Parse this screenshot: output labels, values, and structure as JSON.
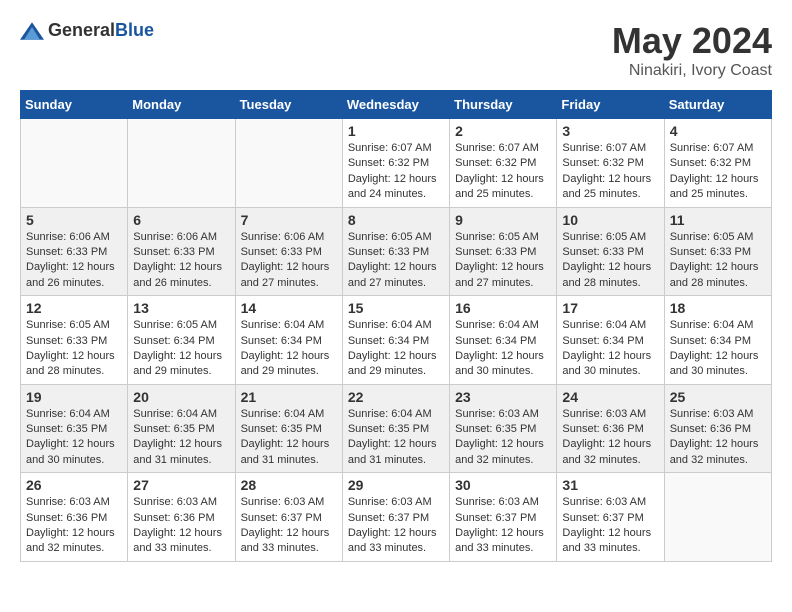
{
  "header": {
    "logo_general": "General",
    "logo_blue": "Blue",
    "month_year": "May 2024",
    "location": "Ninakiri, Ivory Coast"
  },
  "calendar": {
    "days_of_week": [
      "Sunday",
      "Monday",
      "Tuesday",
      "Wednesday",
      "Thursday",
      "Friday",
      "Saturday"
    ],
    "weeks": [
      {
        "shaded": false,
        "days": [
          {
            "number": "",
            "info": "",
            "empty": true
          },
          {
            "number": "",
            "info": "",
            "empty": true
          },
          {
            "number": "",
            "info": "",
            "empty": true
          },
          {
            "number": "1",
            "info": "Sunrise: 6:07 AM\nSunset: 6:32 PM\nDaylight: 12 hours\nand 24 minutes.",
            "empty": false
          },
          {
            "number": "2",
            "info": "Sunrise: 6:07 AM\nSunset: 6:32 PM\nDaylight: 12 hours\nand 25 minutes.",
            "empty": false
          },
          {
            "number": "3",
            "info": "Sunrise: 6:07 AM\nSunset: 6:32 PM\nDaylight: 12 hours\nand 25 minutes.",
            "empty": false
          },
          {
            "number": "4",
            "info": "Sunrise: 6:07 AM\nSunset: 6:32 PM\nDaylight: 12 hours\nand 25 minutes.",
            "empty": false
          }
        ]
      },
      {
        "shaded": true,
        "days": [
          {
            "number": "5",
            "info": "Sunrise: 6:06 AM\nSunset: 6:33 PM\nDaylight: 12 hours\nand 26 minutes.",
            "empty": false
          },
          {
            "number": "6",
            "info": "Sunrise: 6:06 AM\nSunset: 6:33 PM\nDaylight: 12 hours\nand 26 minutes.",
            "empty": false
          },
          {
            "number": "7",
            "info": "Sunrise: 6:06 AM\nSunset: 6:33 PM\nDaylight: 12 hours\nand 27 minutes.",
            "empty": false
          },
          {
            "number": "8",
            "info": "Sunrise: 6:05 AM\nSunset: 6:33 PM\nDaylight: 12 hours\nand 27 minutes.",
            "empty": false
          },
          {
            "number": "9",
            "info": "Sunrise: 6:05 AM\nSunset: 6:33 PM\nDaylight: 12 hours\nand 27 minutes.",
            "empty": false
          },
          {
            "number": "10",
            "info": "Sunrise: 6:05 AM\nSunset: 6:33 PM\nDaylight: 12 hours\nand 28 minutes.",
            "empty": false
          },
          {
            "number": "11",
            "info": "Sunrise: 6:05 AM\nSunset: 6:33 PM\nDaylight: 12 hours\nand 28 minutes.",
            "empty": false
          }
        ]
      },
      {
        "shaded": false,
        "days": [
          {
            "number": "12",
            "info": "Sunrise: 6:05 AM\nSunset: 6:33 PM\nDaylight: 12 hours\nand 28 minutes.",
            "empty": false
          },
          {
            "number": "13",
            "info": "Sunrise: 6:05 AM\nSunset: 6:34 PM\nDaylight: 12 hours\nand 29 minutes.",
            "empty": false
          },
          {
            "number": "14",
            "info": "Sunrise: 6:04 AM\nSunset: 6:34 PM\nDaylight: 12 hours\nand 29 minutes.",
            "empty": false
          },
          {
            "number": "15",
            "info": "Sunrise: 6:04 AM\nSunset: 6:34 PM\nDaylight: 12 hours\nand 29 minutes.",
            "empty": false
          },
          {
            "number": "16",
            "info": "Sunrise: 6:04 AM\nSunset: 6:34 PM\nDaylight: 12 hours\nand 30 minutes.",
            "empty": false
          },
          {
            "number": "17",
            "info": "Sunrise: 6:04 AM\nSunset: 6:34 PM\nDaylight: 12 hours\nand 30 minutes.",
            "empty": false
          },
          {
            "number": "18",
            "info": "Sunrise: 6:04 AM\nSunset: 6:34 PM\nDaylight: 12 hours\nand 30 minutes.",
            "empty": false
          }
        ]
      },
      {
        "shaded": true,
        "days": [
          {
            "number": "19",
            "info": "Sunrise: 6:04 AM\nSunset: 6:35 PM\nDaylight: 12 hours\nand 30 minutes.",
            "empty": false
          },
          {
            "number": "20",
            "info": "Sunrise: 6:04 AM\nSunset: 6:35 PM\nDaylight: 12 hours\nand 31 minutes.",
            "empty": false
          },
          {
            "number": "21",
            "info": "Sunrise: 6:04 AM\nSunset: 6:35 PM\nDaylight: 12 hours\nand 31 minutes.",
            "empty": false
          },
          {
            "number": "22",
            "info": "Sunrise: 6:04 AM\nSunset: 6:35 PM\nDaylight: 12 hours\nand 31 minutes.",
            "empty": false
          },
          {
            "number": "23",
            "info": "Sunrise: 6:03 AM\nSunset: 6:35 PM\nDaylight: 12 hours\nand 32 minutes.",
            "empty": false
          },
          {
            "number": "24",
            "info": "Sunrise: 6:03 AM\nSunset: 6:36 PM\nDaylight: 12 hours\nand 32 minutes.",
            "empty": false
          },
          {
            "number": "25",
            "info": "Sunrise: 6:03 AM\nSunset: 6:36 PM\nDaylight: 12 hours\nand 32 minutes.",
            "empty": false
          }
        ]
      },
      {
        "shaded": false,
        "days": [
          {
            "number": "26",
            "info": "Sunrise: 6:03 AM\nSunset: 6:36 PM\nDaylight: 12 hours\nand 32 minutes.",
            "empty": false
          },
          {
            "number": "27",
            "info": "Sunrise: 6:03 AM\nSunset: 6:36 PM\nDaylight: 12 hours\nand 33 minutes.",
            "empty": false
          },
          {
            "number": "28",
            "info": "Sunrise: 6:03 AM\nSunset: 6:37 PM\nDaylight: 12 hours\nand 33 minutes.",
            "empty": false
          },
          {
            "number": "29",
            "info": "Sunrise: 6:03 AM\nSunset: 6:37 PM\nDaylight: 12 hours\nand 33 minutes.",
            "empty": false
          },
          {
            "number": "30",
            "info": "Sunrise: 6:03 AM\nSunset: 6:37 PM\nDaylight: 12 hours\nand 33 minutes.",
            "empty": false
          },
          {
            "number": "31",
            "info": "Sunrise: 6:03 AM\nSunset: 6:37 PM\nDaylight: 12 hours\nand 33 minutes.",
            "empty": false
          },
          {
            "number": "",
            "info": "",
            "empty": true
          }
        ]
      }
    ]
  }
}
